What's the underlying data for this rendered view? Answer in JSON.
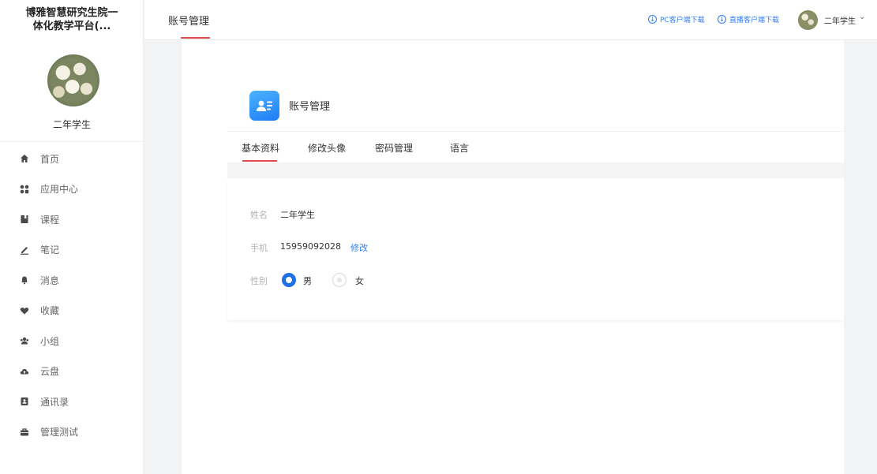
{
  "sidebar": {
    "brand_line1": "博雅智慧研究生院一",
    "brand_line2": "体化教学平台(...",
    "username": "二年学生",
    "items": [
      {
        "label": "首页",
        "icon": "home-icon"
      },
      {
        "label": "应用中心",
        "icon": "apps-icon"
      },
      {
        "label": "课程",
        "icon": "book-icon"
      },
      {
        "label": "笔记",
        "icon": "note-icon"
      },
      {
        "label": "消息",
        "icon": "bell-icon"
      },
      {
        "label": "收藏",
        "icon": "heart-icon"
      },
      {
        "label": "小组",
        "icon": "group-icon"
      },
      {
        "label": "云盘",
        "icon": "cloud-icon"
      },
      {
        "label": "通讯录",
        "icon": "contacts-icon"
      },
      {
        "label": "管理测试",
        "icon": "briefcase-icon"
      }
    ]
  },
  "header": {
    "page_tab": "账号管理",
    "pc_download": "PC客户端下载",
    "live_download": "直播客户端下载",
    "username": "二年学生"
  },
  "panel": {
    "title": "账号管理",
    "tabs": [
      "基本资料",
      "修改头像",
      "密码管理",
      "语言"
    ],
    "active_tab": "基本资料",
    "name_label": "姓名",
    "name_value": "二年学生",
    "phone_label": "手机",
    "phone_value": "15959092028",
    "phone_edit": "修改",
    "gender_label": "性别",
    "gender_options": [
      "男",
      "女"
    ],
    "gender_selected": "男"
  },
  "colors": {
    "accent_blue": "#1f6fe8",
    "link_blue": "#2f7df6",
    "active_red": "#e14b4b"
  }
}
